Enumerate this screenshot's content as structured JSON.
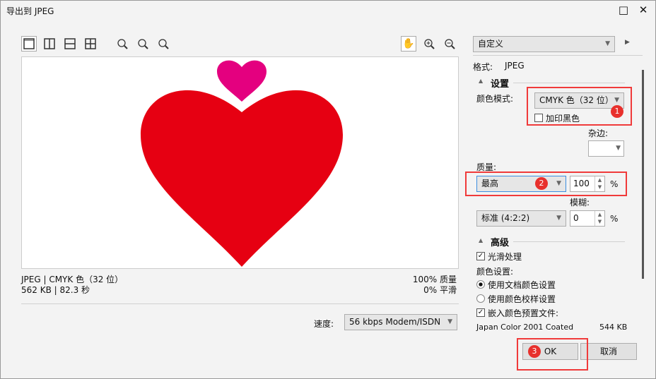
{
  "window": {
    "title": "导出到 JPEG",
    "maximize": "□",
    "close": "✕"
  },
  "preset": {
    "value": "自定义"
  },
  "format": {
    "label": "格式:",
    "value": "JPEG"
  },
  "settings": {
    "header": "设置",
    "color_mode_label": "颜色模式:",
    "color_mode": "CMYK 色（32 位）",
    "overprint_black": "加印黑色",
    "matte_label": "杂边:",
    "quality_label": "质量:",
    "quality": "最高",
    "quality_value": "100",
    "percent": "%",
    "blur_label": "模糊:",
    "subsampling": "标准 (4:2:2)",
    "blur_value": "0"
  },
  "advanced": {
    "header": "高级",
    "smoothing": "光滑处理",
    "color_settings_label": "颜色设置:",
    "use_document": "使用文档颜色设置",
    "use_proof": "使用颜色校样设置",
    "embed_profile": "嵌入颜色预置文件:",
    "profile_name": "Japan Color 2001 Coated",
    "profile_size": "544 KB"
  },
  "status": {
    "line1": "JPEG | CMYK 色（32 位）",
    "line2": "562 KB | 82.3 秒",
    "quality": "100% 质量",
    "smoothing": "0% 平滑"
  },
  "speed": {
    "label": "速度:",
    "value": "56 kbps Modem/ISDN"
  },
  "buttons": {
    "ok": "OK",
    "cancel": "取消"
  },
  "badges": [
    "1",
    "2",
    "3"
  ],
  "colors": {
    "red_heart": "#e60012",
    "pink_heart": "#e4007f",
    "annotation": "#f03a3a"
  }
}
